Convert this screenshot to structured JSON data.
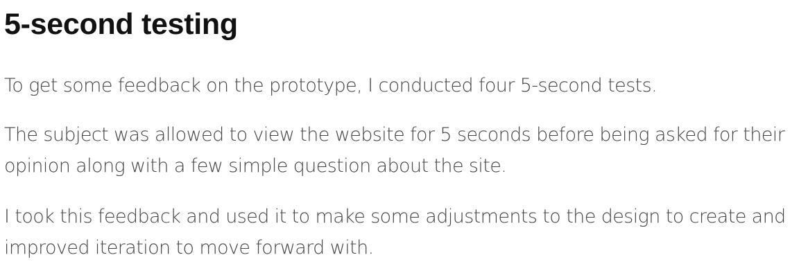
{
  "heading": "5-second testing",
  "paragraphs": [
    "To get some feedback on the prototype, I conducted four 5-second tests.",
    "The subject was allowed to view the website for 5 seconds before being asked for their opinion along with a few simple question about the site.",
    "I took this feedback and used it to make some adjustments to the design to create and improved iteration to move forward with."
  ],
  "colors": {
    "heading": "#111111",
    "body_text": "#444444",
    "background": "#ffffff"
  }
}
